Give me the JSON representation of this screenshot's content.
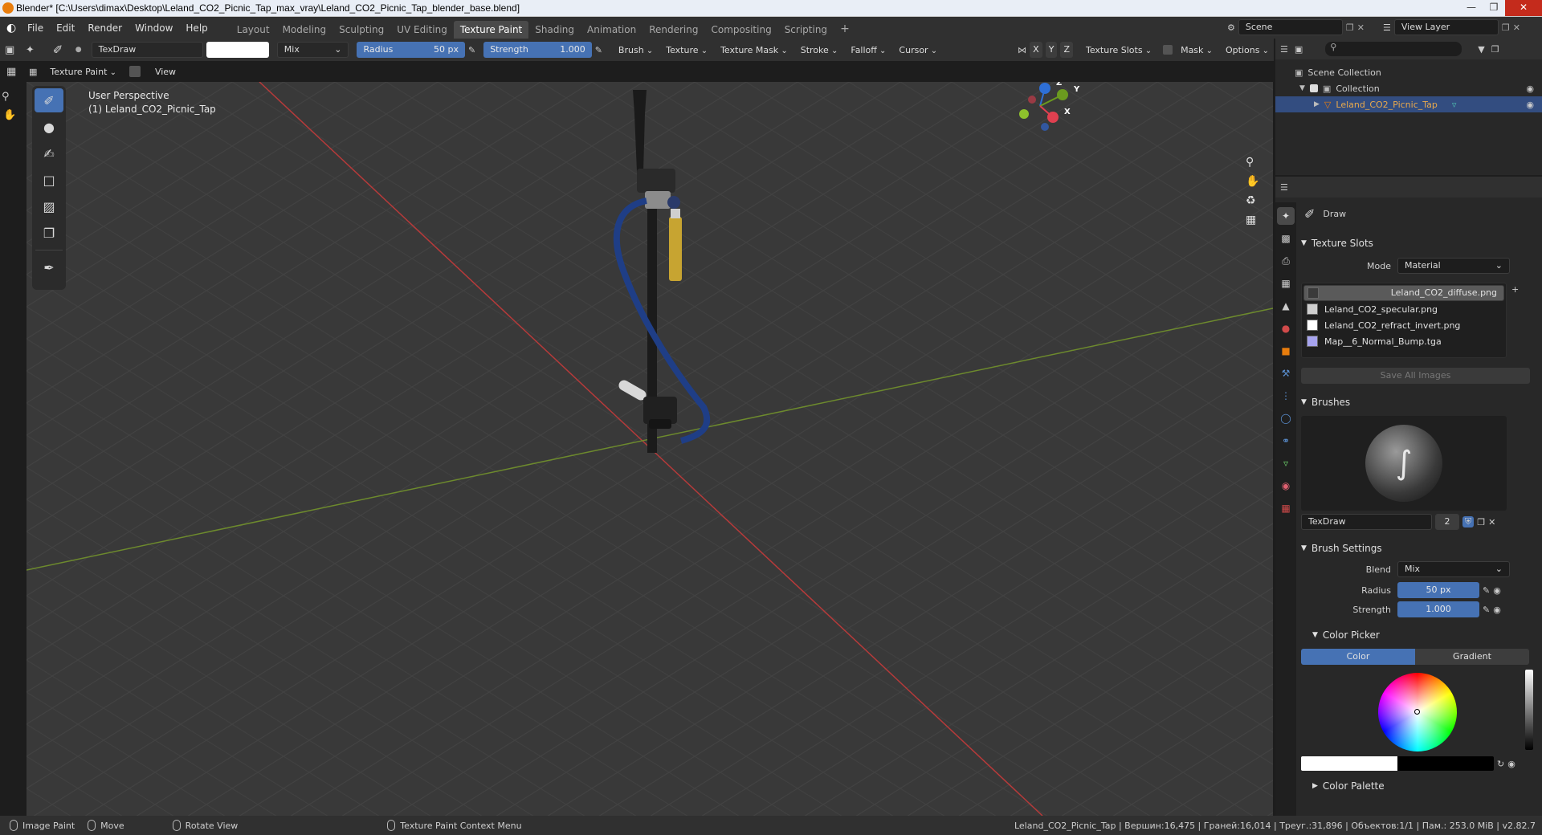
{
  "title_bar": {
    "title": "Blender* [C:\\Users\\dimax\\Desktop\\Leland_CO2_Picnic_Tap_max_vray\\Leland_CO2_Picnic_Tap_blender_base.blend]"
  },
  "menu": [
    "File",
    "Edit",
    "Render",
    "Window",
    "Help"
  ],
  "workspaces": [
    {
      "label": "Layout",
      "active": false
    },
    {
      "label": "Modeling",
      "active": false
    },
    {
      "label": "Sculpting",
      "active": false
    },
    {
      "label": "UV Editing",
      "active": false
    },
    {
      "label": "Texture Paint",
      "active": true
    },
    {
      "label": "Shading",
      "active": false
    },
    {
      "label": "Animation",
      "active": false
    },
    {
      "label": "Rendering",
      "active": false
    },
    {
      "label": "Compositing",
      "active": false
    },
    {
      "label": "Scripting",
      "active": false
    }
  ],
  "topright": {
    "scene": "Scene",
    "view_layer": "View Layer"
  },
  "header": {
    "brush_name": "TexDraw",
    "blend_mode": "Mix",
    "radius_label": "Radius",
    "radius_value": "50 px",
    "strength_label": "Strength",
    "strength_value": "1.000",
    "menus": [
      "Brush",
      "Texture",
      "Texture Mask",
      "Stroke",
      "Falloff",
      "Cursor"
    ],
    "axis": [
      "X",
      "Y",
      "Z"
    ],
    "texture_slots": "Texture Slots",
    "mask": "Mask",
    "options": "Options"
  },
  "header2": {
    "mode": "Texture Paint",
    "view": "View"
  },
  "viewport": {
    "perspective": "User Perspective",
    "object": "(1) Leland_CO2_Picnic_Tap"
  },
  "gizmo": {
    "x": "X",
    "y": "Y",
    "z": "Z"
  },
  "outliner": {
    "scene_collection": "Scene Collection",
    "collection": "Collection",
    "object": "Leland_CO2_Picnic_Tap"
  },
  "properties": {
    "tool": "Draw",
    "texture_slots_title": "Texture Slots",
    "mode_label": "Mode",
    "mode_value": "Material",
    "textures": [
      {
        "name": "Leland_CO2_diffuse.png",
        "color": "#3a3a3a",
        "selected": true
      },
      {
        "name": "Leland_CO2_specular.png",
        "color": "#cfcfcf",
        "selected": false
      },
      {
        "name": "Leland_CO2_refract_invert.png",
        "color": "#ffffff",
        "selected": false
      },
      {
        "name": "Map__6_Normal_Bump.tga",
        "color": "#a7a4ef",
        "selected": false
      }
    ],
    "save_all": "Save All Images",
    "brushes_title": "Brushes",
    "brush_name": "TexDraw",
    "brush_users": "2",
    "brush_settings_title": "Brush Settings",
    "blend_label": "Blend",
    "blend_value": "Mix",
    "radius_label": "Radius",
    "radius_value": "50 px",
    "strength_label": "Strength",
    "strength_value": "1.000",
    "color_picker_title": "Color Picker",
    "color_tab": "Color",
    "gradient_tab": "Gradient",
    "color_palette_title": "Color Palette"
  },
  "status": {
    "image_paint": "Image Paint",
    "move": "Move",
    "rotate": "Rotate View",
    "context_menu": "Texture Paint Context Menu",
    "stats": "Leland_CO2_Picnic_Tap | Вершин:16,475 | Граней:16,014 | Треуг.:31,896 | Объектов:1/1 | Пам.: 253.0 MiB | v2.82.7"
  },
  "colors": {
    "accent": "#4672b4",
    "selected_row": "#334d80",
    "axis_x": "#b63a3a",
    "axis_y": "#6d8a2d"
  }
}
